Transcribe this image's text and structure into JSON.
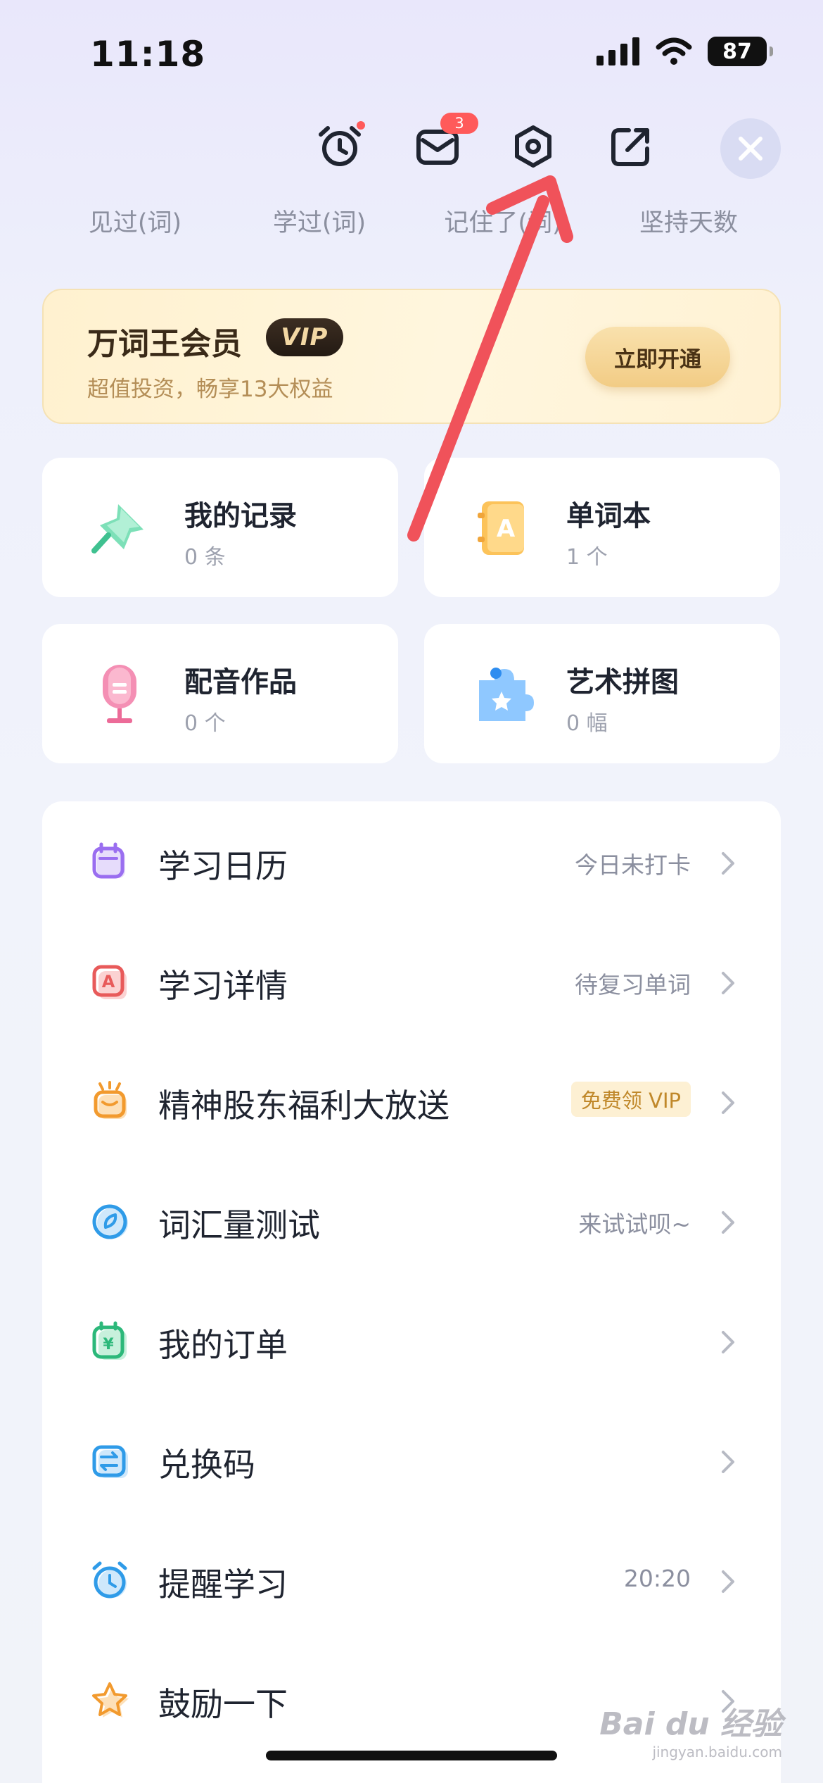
{
  "status_bar": {
    "time": "11:18",
    "battery": "87"
  },
  "header": {
    "mail_badge": "3",
    "stats": [
      "见过(词)",
      "学过(词)",
      "记住了(词)",
      "坚持天数"
    ]
  },
  "vip": {
    "title": "万词王会员",
    "tag": "VIP",
    "subtitle": "超值投资，畅享13大权益",
    "button": "立即开通"
  },
  "cards": [
    {
      "title": "我的记录",
      "sub": "0 条",
      "icon": "pin-icon"
    },
    {
      "title": "单词本",
      "sub": "1 个",
      "icon": "wordbook-icon"
    },
    {
      "title": "配音作品",
      "sub": "0 个",
      "icon": "microphone-icon"
    },
    {
      "title": "艺术拼图",
      "sub": "0 幅",
      "icon": "puzzle-icon"
    }
  ],
  "menu": [
    {
      "label": "学习日历",
      "right": "今日未打卡",
      "icon": "calendar-icon"
    },
    {
      "label": "学习详情",
      "right": "待复习单词",
      "icon": "study-detail-icon"
    },
    {
      "label": "精神股东福利大放送",
      "right": "免费领 VIP",
      "icon": "gift-icon"
    },
    {
      "label": "词汇量测试",
      "right": "来试试呗~",
      "icon": "compass-icon"
    },
    {
      "label": "我的订单",
      "right": "",
      "icon": "order-icon"
    },
    {
      "label": "兑换码",
      "right": "",
      "icon": "exchange-icon"
    },
    {
      "label": "提醒学习",
      "right": "20:20",
      "icon": "alarm-icon"
    },
    {
      "label": "鼓励一下",
      "right": "",
      "icon": "star-icon"
    }
  ],
  "watermark": {
    "top": "Bai du 经验",
    "bottom": "jingyan.baidu.com"
  },
  "colors": {
    "accent_red": "#ff5a5a",
    "annotation_arrow": "#f0525a",
    "vip_gold": "#c0882a"
  }
}
